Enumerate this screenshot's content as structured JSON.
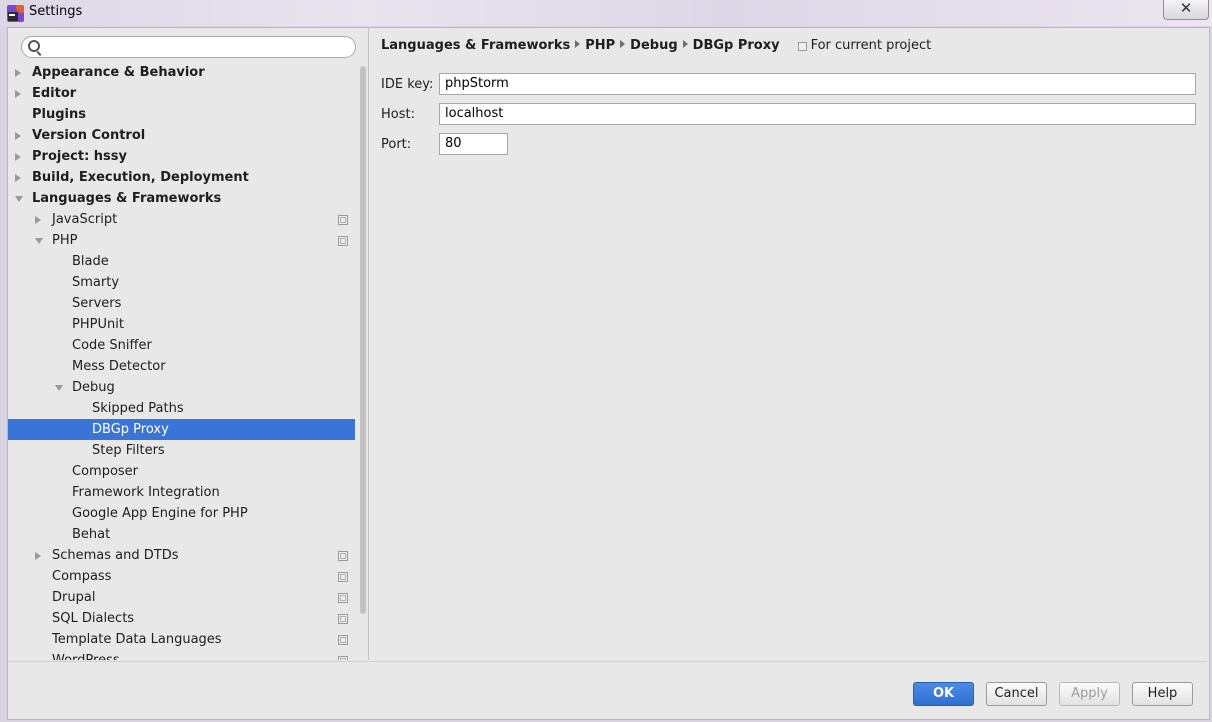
{
  "window": {
    "title": "Settings",
    "close_glyph": "✕"
  },
  "search": {
    "placeholder": ""
  },
  "tree": {
    "items": [
      {
        "label": "Appearance & Behavior",
        "level": 0,
        "bold": true,
        "expander": "right"
      },
      {
        "label": "Editor",
        "level": 0,
        "bold": true,
        "expander": "right"
      },
      {
        "label": "Plugins",
        "level": 0,
        "bold": true,
        "expander": "none"
      },
      {
        "label": "Version Control",
        "level": 0,
        "bold": true,
        "expander": "right"
      },
      {
        "label": "Project: hssy",
        "level": 0,
        "bold": true,
        "expander": "right"
      },
      {
        "label": "Build, Execution, Deployment",
        "level": 0,
        "bold": true,
        "expander": "right"
      },
      {
        "label": "Languages & Frameworks",
        "level": 0,
        "bold": true,
        "expander": "down"
      },
      {
        "label": "JavaScript",
        "level": 1,
        "expander": "right",
        "project_icon": true
      },
      {
        "label": "PHP",
        "level": 1,
        "expander": "down",
        "project_icon": true
      },
      {
        "label": "Blade",
        "level": 2
      },
      {
        "label": "Smarty",
        "level": 2
      },
      {
        "label": "Servers",
        "level": 2
      },
      {
        "label": "PHPUnit",
        "level": 2
      },
      {
        "label": "Code Sniffer",
        "level": 2
      },
      {
        "label": "Mess Detector",
        "level": 2
      },
      {
        "label": "Debug",
        "level": 2,
        "expander": "down"
      },
      {
        "label": "Skipped Paths",
        "level": 3
      },
      {
        "label": "DBGp Proxy",
        "level": 3,
        "selected": true
      },
      {
        "label": "Step Filters",
        "level": 3
      },
      {
        "label": "Composer",
        "level": 2
      },
      {
        "label": "Framework Integration",
        "level": 2
      },
      {
        "label": "Google App Engine for PHP",
        "level": 2
      },
      {
        "label": "Behat",
        "level": 2
      },
      {
        "label": "Schemas and DTDs",
        "level": 1,
        "expander": "right",
        "project_icon": true
      },
      {
        "label": "Compass",
        "level": 1,
        "project_icon": true
      },
      {
        "label": "Drupal",
        "level": 1,
        "project_icon": true
      },
      {
        "label": "SQL Dialects",
        "level": 1,
        "project_icon": true
      },
      {
        "label": "Template Data Languages",
        "level": 1,
        "project_icon": true
      },
      {
        "label": "WordPress",
        "level": 1,
        "project_icon": true
      }
    ]
  },
  "breadcrumb": {
    "items": [
      "Languages & Frameworks",
      "PHP",
      "Debug",
      "DBGp Proxy"
    ],
    "scope": "For current project"
  },
  "form": {
    "ide_key": {
      "label": "IDE key:",
      "value": "phpStorm"
    },
    "host": {
      "label": "Host:",
      "value": "localhost"
    },
    "port": {
      "label": "Port:",
      "value": "80"
    }
  },
  "buttons": {
    "ok": "OK",
    "cancel": "Cancel",
    "apply": "Apply",
    "help": "Help"
  },
  "colors": {
    "selection": "#3875d7",
    "primary_button": "#3a7bdc"
  }
}
